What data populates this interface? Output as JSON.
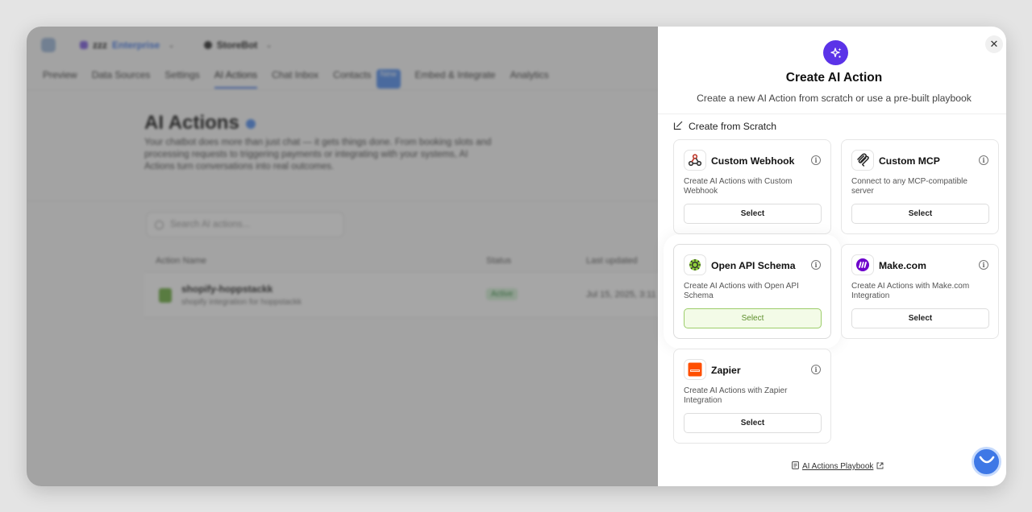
{
  "background": {
    "workspace": {
      "name": "zzz",
      "badge": "Enterprise"
    },
    "bot": {
      "name": "StoreBot"
    },
    "nav_tabs": [
      "Preview",
      "Data Sources",
      "Settings",
      "AI Actions",
      "Chat Inbox",
      "Contacts",
      "Embed & Integrate",
      "Analytics"
    ],
    "new_badge": "New",
    "page_title": "AI Actions",
    "page_description": "Your chatbot does more than just chat — it gets things done. From booking slots and processing requests to triggering payments or integrating with your systems, AI Actions turn conversations into real outcomes.",
    "search_placeholder": "Search AI actions...",
    "table": {
      "columns": [
        "Action Name",
        "Status",
        "Last updated"
      ],
      "row": {
        "name": "shopify-hoppstackk",
        "subtitle": "shopify integration for hoppstackk",
        "status": "Active",
        "updated": "Jul 15, 2025, 3:11"
      }
    }
  },
  "modal": {
    "close_label": "✕",
    "title": "Create AI Action",
    "subtitle": "Create a new AI Action from scratch or use a pre-built playbook",
    "section_label": "Create from Scratch",
    "info_glyph": "i",
    "cards": [
      {
        "name": "Custom Webhook",
        "desc": "Create AI Actions with Custom Webhook",
        "button": "Select"
      },
      {
        "name": "Custom MCP",
        "desc": "Connect to any MCP-compatible server",
        "button": "Select"
      },
      {
        "name": "Open API Schema",
        "desc": "Create AI Actions with Open API Schema",
        "button": "Select"
      },
      {
        "name": "Make.com",
        "desc": "Create AI Actions with Make.com Integration",
        "button": "Select"
      },
      {
        "name": "Zapier",
        "desc": "Create AI Actions with Zapier Integration",
        "button": "Select"
      }
    ],
    "footer_link": "AI Actions Playbook"
  },
  "colors": {
    "accent": "#5b33e8",
    "selected_fill": "#f3fbe7",
    "selected_text": "#5f8f2e",
    "zapier": "#ff4f00",
    "make": "#6d00cc",
    "chat_bubble": "#3e78e6"
  }
}
